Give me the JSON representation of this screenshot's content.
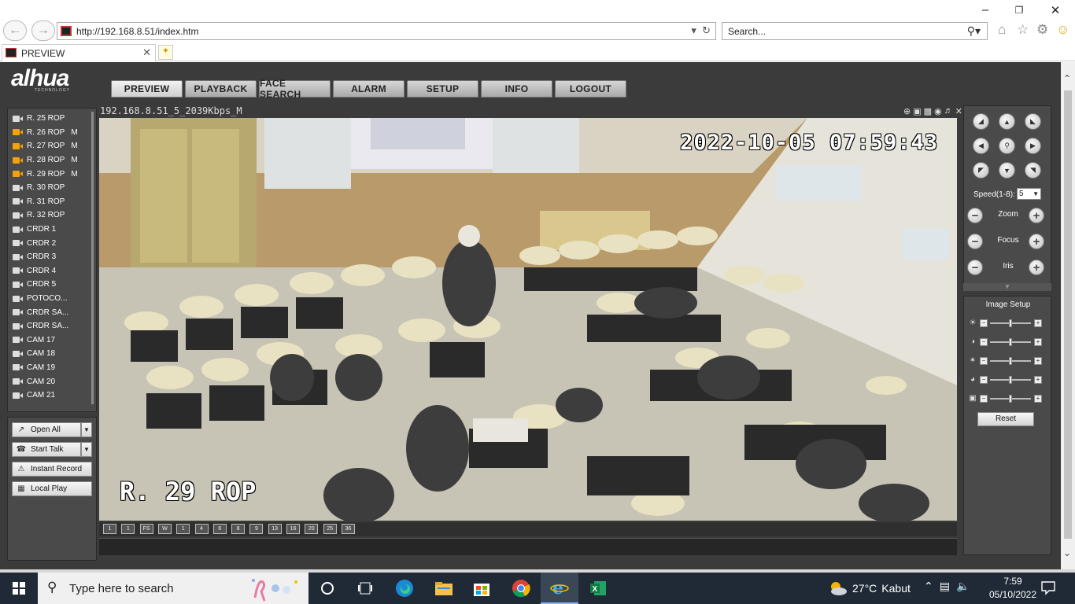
{
  "browser": {
    "url": "http://192.168.8.51/index.htm",
    "search_placeholder": "Search...",
    "tab_title": "PREVIEW"
  },
  "app": {
    "logo_text": "alhua",
    "logo_sub": "TECHNOLOGY",
    "nav": [
      "PREVIEW",
      "PLAYBACK",
      "FACE SEARCH",
      "ALARM",
      "SETUP",
      "INFO",
      "LOGOUT"
    ],
    "active_nav": "PREVIEW",
    "channels": [
      {
        "name": "R. 25 ROP",
        "active": false,
        "flag": ""
      },
      {
        "name": "R. 26 ROP",
        "active": true,
        "flag": "M"
      },
      {
        "name": "R. 27 ROP",
        "active": true,
        "flag": "M"
      },
      {
        "name": "R. 28 ROP",
        "active": true,
        "flag": "M"
      },
      {
        "name": "R. 29 ROP",
        "active": true,
        "flag": "M"
      },
      {
        "name": "R. 30 ROP",
        "active": false,
        "flag": ""
      },
      {
        "name": "R. 31 ROP",
        "active": false,
        "flag": ""
      },
      {
        "name": "R. 32 ROP",
        "active": false,
        "flag": ""
      },
      {
        "name": "CRDR 1",
        "active": false,
        "flag": ""
      },
      {
        "name": "CRDR 2",
        "active": false,
        "flag": ""
      },
      {
        "name": "CRDR 3",
        "active": false,
        "flag": ""
      },
      {
        "name": "CRDR 4",
        "active": false,
        "flag": ""
      },
      {
        "name": "CRDR 5",
        "active": false,
        "flag": ""
      },
      {
        "name": "POTOCO...",
        "active": false,
        "flag": ""
      },
      {
        "name": "CRDR SA...",
        "active": false,
        "flag": ""
      },
      {
        "name": "CRDR SA...",
        "active": false,
        "flag": ""
      },
      {
        "name": "CAM 17",
        "active": false,
        "flag": ""
      },
      {
        "name": "CAM 18",
        "active": false,
        "flag": ""
      },
      {
        "name": "CAM 19",
        "active": false,
        "flag": ""
      },
      {
        "name": "CAM 20",
        "active": false,
        "flag": ""
      },
      {
        "name": "CAM 21",
        "active": false,
        "flag": ""
      }
    ],
    "controls": {
      "open_all": "Open All",
      "start_talk": "Start Talk",
      "instant_record": "Instant Record",
      "local_play": "Local Play"
    },
    "video": {
      "stream_title": "192.168.8.51_5_2039Kbps_M",
      "osd_timestamp": "2022-10-05 07:59:43",
      "osd_channel": "R. 29 ROP"
    },
    "layouts": [
      "1",
      "1",
      "FS",
      "W",
      "1",
      "4",
      "6",
      "8",
      "9",
      "13",
      "16",
      "20",
      "25",
      "36"
    ],
    "ptz": {
      "speed_label": "Speed(1-8):",
      "speed_value": "5",
      "zoom": "Zoom",
      "focus": "Focus",
      "iris": "Iris"
    },
    "image_setup": {
      "title": "Image Setup",
      "reset": "Reset",
      "rows": [
        {
          "icon": "brightness-icon",
          "level": 0.5
        },
        {
          "icon": "contrast-icon",
          "level": 0.5
        },
        {
          "icon": "saturation-icon",
          "level": 0.5
        },
        {
          "icon": "hue-icon",
          "level": 0.5
        },
        {
          "icon": "gain-icon",
          "level": 0.5
        }
      ]
    }
  },
  "taskbar": {
    "search_placeholder": "Type here to search",
    "temperature": "27°C",
    "weather": "Kabut",
    "time": "7:59",
    "date": "05/10/2022"
  },
  "colors": {
    "app_bg": "#3b3b3b",
    "active_channel": "#f2a20a",
    "taskbar": "#1f2a36"
  }
}
